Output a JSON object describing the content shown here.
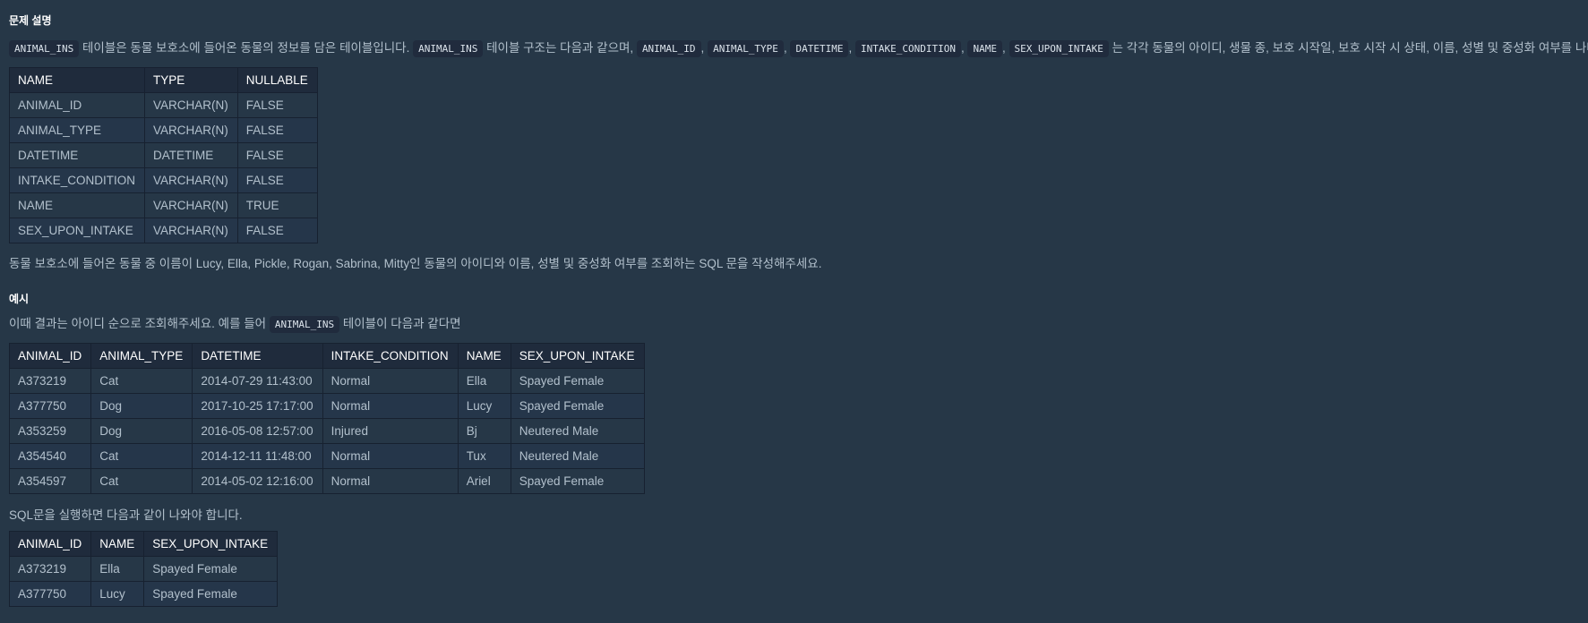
{
  "section_title": "문제 설명",
  "desc": {
    "code_table": "ANIMAL_INS",
    "part1": "테이블은 동물 보호소에 들어온 동물의 정보를 담은 테이블입니다.",
    "code_table2": "ANIMAL_INS",
    "part2": "테이블 구조는 다음과 같으며,",
    "cols": [
      "ANIMAL_ID",
      "ANIMAL_TYPE",
      "DATETIME",
      "INTAKE_CONDITION",
      "NAME",
      "SEX_UPON_INTAKE"
    ],
    "sep": ",",
    "part3": "는 각각 동물의 아이디, 생물 종, 보호 시작일, 보호 시작 시 상태, 이름, 성별 및 중성화 여부를 나타냅니다."
  },
  "schema_table": {
    "headers": [
      "NAME",
      "TYPE",
      "NULLABLE"
    ],
    "rows": [
      [
        "ANIMAL_ID",
        "VARCHAR(N)",
        "FALSE"
      ],
      [
        "ANIMAL_TYPE",
        "VARCHAR(N)",
        "FALSE"
      ],
      [
        "DATETIME",
        "DATETIME",
        "FALSE"
      ],
      [
        "INTAKE_CONDITION",
        "VARCHAR(N)",
        "FALSE"
      ],
      [
        "NAME",
        "VARCHAR(N)",
        "TRUE"
      ],
      [
        "SEX_UPON_INTAKE",
        "VARCHAR(N)",
        "FALSE"
      ]
    ]
  },
  "question": "동물 보호소에 들어온 동물 중 이름이 Lucy, Ella, Pickle, Rogan, Sabrina, Mitty인 동물의 아이디와 이름, 성별 및 중성화 여부를 조회하는 SQL 문을 작성해주세요.",
  "example_title": "예시",
  "example_desc": {
    "part1": "이때 결과는 아이디 순으로 조회해주세요. 예를 들어",
    "code": "ANIMAL_INS",
    "part2": "테이블이 다음과 같다면"
  },
  "example_table": {
    "headers": [
      "ANIMAL_ID",
      "ANIMAL_TYPE",
      "DATETIME",
      "INTAKE_CONDITION",
      "NAME",
      "SEX_UPON_INTAKE"
    ],
    "rows": [
      [
        "A373219",
        "Cat",
        "2014-07-29 11:43:00",
        "Normal",
        "Ella",
        "Spayed Female"
      ],
      [
        "A377750",
        "Dog",
        "2017-10-25 17:17:00",
        "Normal",
        "Lucy",
        "Spayed Female"
      ],
      [
        "A353259",
        "Dog",
        "2016-05-08 12:57:00",
        "Injured",
        "Bj",
        "Neutered Male"
      ],
      [
        "A354540",
        "Cat",
        "2014-12-11 11:48:00",
        "Normal",
        "Tux",
        "Neutered Male"
      ],
      [
        "A354597",
        "Cat",
        "2014-05-02 12:16:00",
        "Normal",
        "Ariel",
        "Spayed Female"
      ]
    ]
  },
  "result_desc": "SQL문을 실행하면 다음과 같이 나와야 합니다.",
  "result_table": {
    "headers": [
      "ANIMAL_ID",
      "NAME",
      "SEX_UPON_INTAKE"
    ],
    "rows": [
      [
        "A373219",
        "Ella",
        "Spayed Female"
      ],
      [
        "A377750",
        "Lucy",
        "Spayed Female"
      ]
    ]
  }
}
